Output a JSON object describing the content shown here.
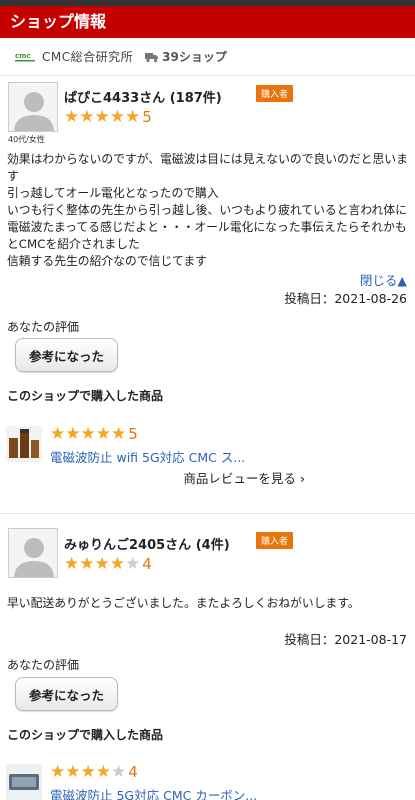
{
  "header": {
    "title": "ショップ情報"
  },
  "shop": {
    "name": "CMC総合研究所",
    "count": "39ショップ"
  },
  "reviews": [
    {
      "name": "ぱぴこ4433さん (187件)",
      "badge": "購入者",
      "age": "40代/女性",
      "rating_stars": "★★★★★",
      "rating_off": "",
      "rating": "5",
      "text": "効果はわからないのですが、電磁波は目には見えないので良いのだと思います\n引っ越してオール電化となったので購入\nいつも行く整体の先生から引っ越し後、いつもより疲れていると言われ体に電磁波たまってる感じだよと・・・オール電化になった事伝えたらそれかもとCMCを紹介されました\n信頼する先生の紹介なので信じてます",
      "close": "閉じる▲",
      "date": "投稿日：2021-08-26",
      "eval_label": "あなたの評価",
      "helpful": "参考になった",
      "bought_label": "このショップで購入した商品",
      "product": {
        "stars": "★★★★★",
        "stars_off": "",
        "rating": "5",
        "title": "電磁波防止 wifi 5G対応 CMC ス...",
        "review_link": "商品レビューを見る"
      }
    },
    {
      "name": "みゅりんご2405さん (4件)",
      "badge": "購入者",
      "rating_stars": "★★★★",
      "rating_off": "★",
      "rating": "4",
      "text": "早い配送ありがとうございました。またよろしくおねがいします。",
      "date": "投稿日：2021-08-17",
      "eval_label": "あなたの評価",
      "helpful": "参考になった",
      "bought_label": "このショップで購入した商品",
      "product": {
        "stars": "★★★★",
        "stars_off": "★",
        "rating": "4",
        "title": "電磁波防止 5G対応 CMC カーボン..."
      }
    }
  ]
}
